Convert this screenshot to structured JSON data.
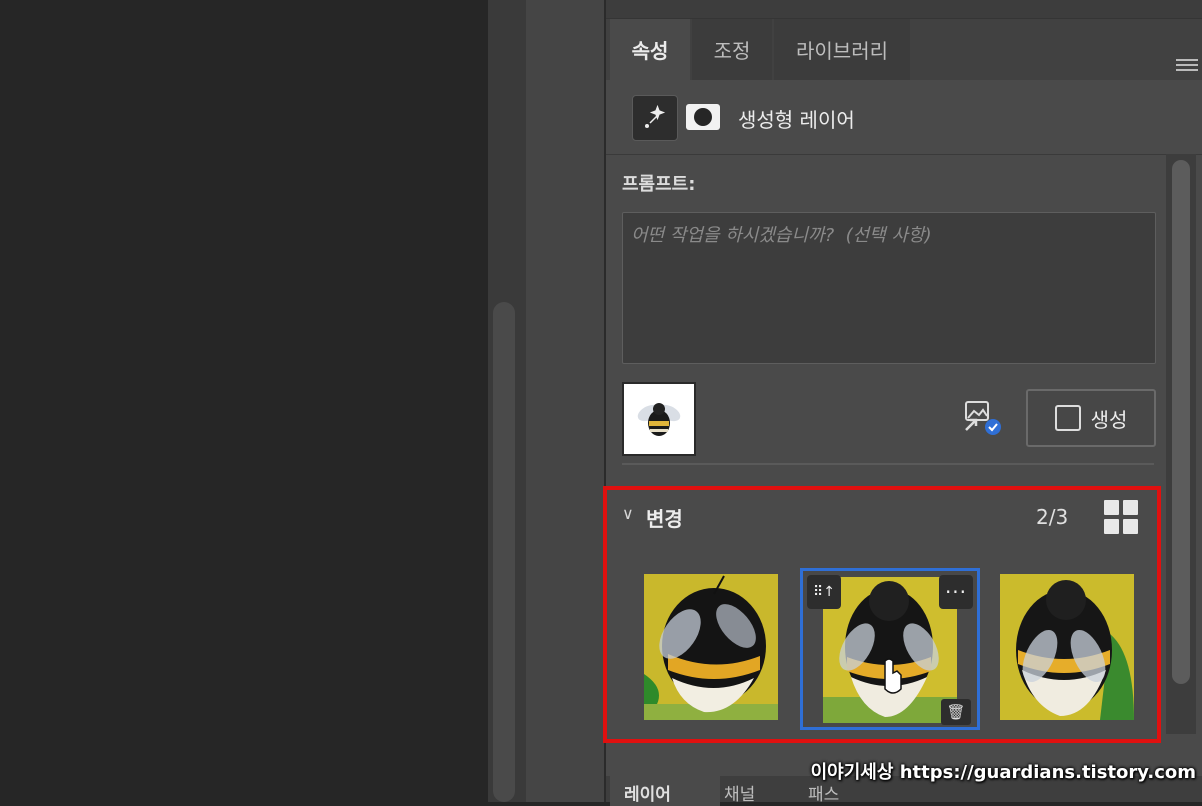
{
  "tabs": [
    {
      "label": "속성",
      "active": true
    },
    {
      "label": "조정",
      "active": false
    },
    {
      "label": "라이브러리",
      "active": false
    }
  ],
  "layer": {
    "title": "생성형 레이어",
    "icon": "generative-sparkle-icon",
    "mask_icon": "mask-icon"
  },
  "prompt": {
    "label": "프롬프트:",
    "value": "",
    "placeholder": "어떤 작업을 하시겠습니까?  (선택 사항)"
  },
  "reference": {
    "image": "bee-reference-image"
  },
  "generate_button": {
    "label": "생성",
    "icon": "generate-icon"
  },
  "variations": {
    "label": "변경",
    "count": "2/3",
    "selected_index": 1,
    "items": [
      {
        "name": "variation-1",
        "image": "bee-variation-1"
      },
      {
        "name": "variation-2",
        "image": "bee-variation-2"
      },
      {
        "name": "variation-3",
        "image": "bee-variation-3"
      }
    ]
  },
  "bottom_tabs": [
    {
      "label": "레이어"
    },
    {
      "label": "채널"
    },
    {
      "label": "패스"
    }
  ],
  "watermark": "이야기세상 https://guardians.tistory.com",
  "colors": {
    "highlight_red": "#e0100f",
    "selection_blue": "#2f6fd6",
    "panel_bg": "#4a4a4a",
    "canvas_bg": "#262626"
  }
}
